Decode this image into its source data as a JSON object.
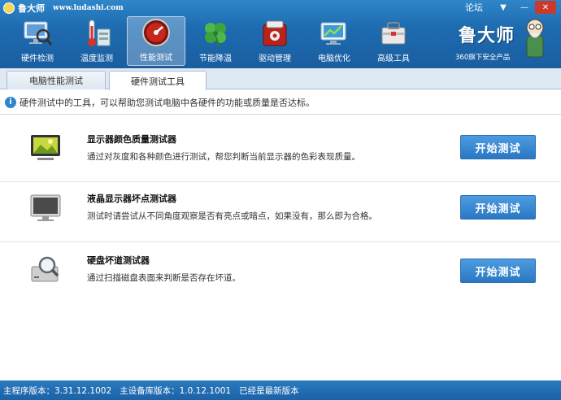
{
  "window": {
    "app_name": "鲁大师",
    "url": "www.ludashi.com",
    "forum_label": "论坛",
    "menu_icon": "chevron-down-icon",
    "minimize_icon": "minimize-icon",
    "close_icon": "close-icon"
  },
  "toolbar": {
    "items": [
      {
        "label": "硬件检测",
        "icon": "monitor-magnifier-icon"
      },
      {
        "label": "温度监测",
        "icon": "thermometer-icon"
      },
      {
        "label": "性能测试",
        "icon": "speedometer-icon",
        "active": true
      },
      {
        "label": "节能降温",
        "icon": "clover-icon"
      },
      {
        "label": "驱动管理",
        "icon": "driver-box-icon"
      },
      {
        "label": "电脑优化",
        "icon": "optimize-icon"
      },
      {
        "label": "高级工具",
        "icon": "toolbox-icon"
      }
    ]
  },
  "brand": {
    "title": "鲁大师",
    "subtitle": "360旗下安全产品"
  },
  "tabs": [
    {
      "label": "电脑性能测试",
      "active": false
    },
    {
      "label": "硬件测试工具",
      "active": true
    }
  ],
  "info": {
    "text": "硬件测试中的工具，可以帮助您测试电脑中各硬件的功能或质量是否达标。"
  },
  "testers": [
    {
      "name": "显示器颜色质量测试器",
      "desc": "通过对灰度和各种颜色进行测试，帮您判断当前显示器的色彩表现质量。",
      "button": "开始测试",
      "icon": "color-monitor-icon"
    },
    {
      "name": "液晶显示器坏点测试器",
      "desc": "测试时请尝试从不同角度观察是否有亮点或暗点，如果没有，那么即为合格。",
      "button": "开始测试",
      "icon": "lcd-monitor-icon"
    },
    {
      "name": "硬盘坏道测试器",
      "desc": "通过扫描磁盘表面来判断是否存在坏道。",
      "button": "开始测试",
      "icon": "harddisk-magnifier-icon"
    }
  ],
  "status": {
    "text": "主程序版本：3.31.12.1002   主设备库版本：1.0.12.1001   已经是最新版本"
  },
  "colors": {
    "toolbar_blue": "#1e6bb0",
    "button_blue": "#2a78c4",
    "status_blue": "#1c62a6"
  }
}
